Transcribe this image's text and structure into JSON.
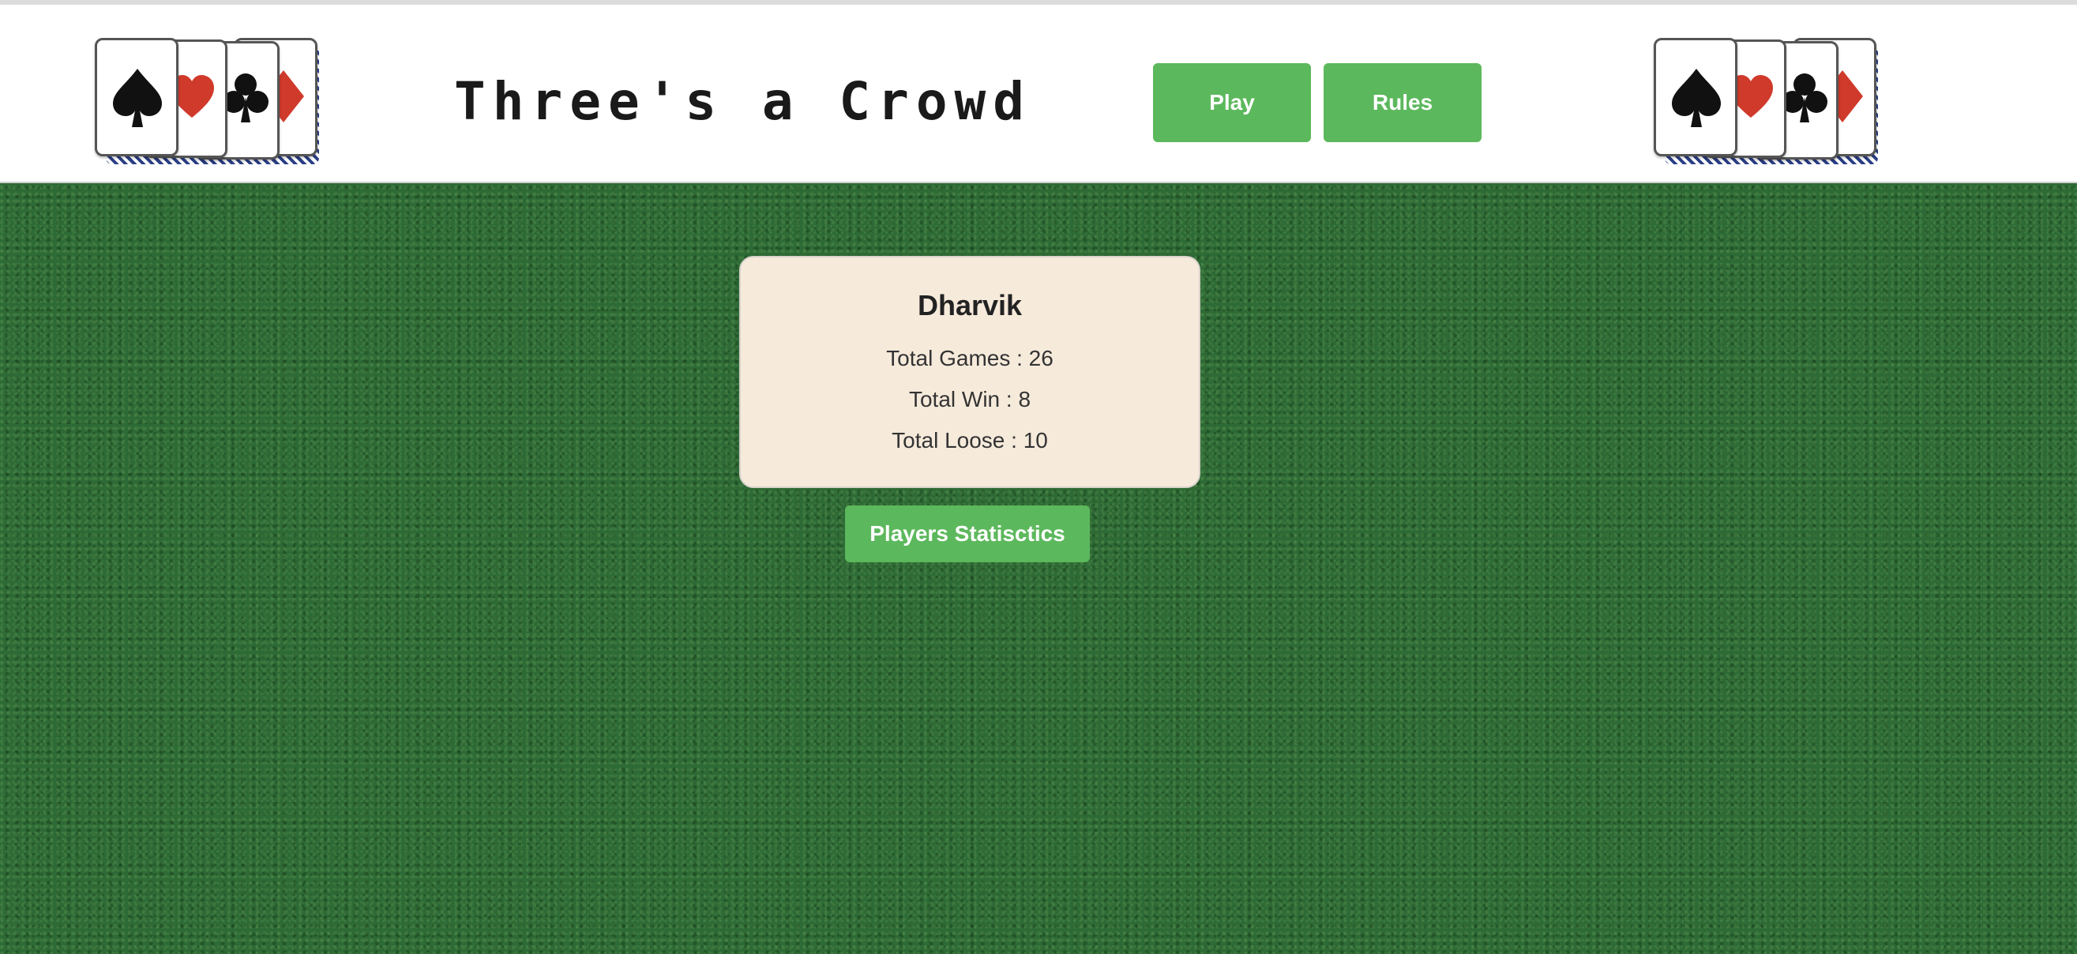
{
  "header": {
    "title": "Three's a Crowd",
    "nav": {
      "play_label": "Play",
      "rules_label": "Rules"
    },
    "decorations": {
      "left_fan_icons": [
        "spade-icon",
        "heart-icon",
        "club-icon",
        "diamond-icon"
      ],
      "right_fan_icons": [
        "spade-icon",
        "heart-icon",
        "club-icon",
        "diamond-icon"
      ]
    }
  },
  "player_card": {
    "name": "Dharvik",
    "total_games": "Total Games : 26",
    "total_win": "Total Win : 8",
    "total_loose": "Total Loose : 10"
  },
  "actions": {
    "stats_button_label": "Players Statisctics"
  },
  "colors": {
    "accent_green": "#5cb85c",
    "card_background": "#f6eadb",
    "felt_green": "#2e6a35",
    "suit_red": "#d03a2b",
    "suit_black": "#111111"
  }
}
